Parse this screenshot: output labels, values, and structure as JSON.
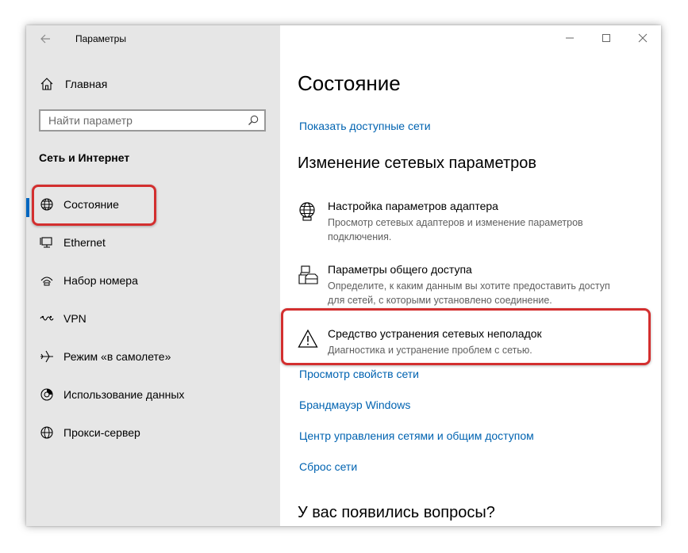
{
  "window": {
    "title": "Параметры",
    "controls": {
      "minimize": "minimize-icon",
      "maximize": "maximize-icon",
      "close": "close-icon"
    }
  },
  "sidebar": {
    "home_label": "Главная",
    "search_placeholder": "Найти параметр",
    "section_title": "Сеть и Интернет",
    "items": [
      {
        "label": "Состояние",
        "icon": "globe-icon",
        "active": true
      },
      {
        "label": "Ethernet",
        "icon": "ethernet-icon"
      },
      {
        "label": "Набор номера",
        "icon": "dialup-icon"
      },
      {
        "label": "VPN",
        "icon": "vpn-icon"
      },
      {
        "label": "Режим «в самолете»",
        "icon": "airplane-icon"
      },
      {
        "label": "Использование данных",
        "icon": "data-usage-icon"
      },
      {
        "label": "Прокси-сервер",
        "icon": "proxy-globe-icon"
      }
    ]
  },
  "main": {
    "title": "Состояние",
    "show_networks_link": "Показать доступные сети",
    "change_heading": "Изменение сетевых параметров",
    "settings": [
      {
        "title": "Настройка параметров адаптера",
        "desc": "Просмотр сетевых адаптеров и изменение параметров подключения.",
        "icon": "adapter-globe-icon"
      },
      {
        "title": "Параметры общего доступа",
        "desc": "Определите, к каким данным вы хотите предоставить доступ для сетей, с которыми установлено соединение.",
        "icon": "sharing-icon"
      },
      {
        "title": "Средство устранения сетевых неполадок",
        "desc": "Диагностика и устранение проблем с сетью.",
        "icon": "warning-icon"
      }
    ],
    "links": [
      "Просмотр свойств сети",
      "Брандмауэр Windows",
      "Центр управления сетями и общим доступом",
      "Сброс сети"
    ],
    "questions_heading": "У вас появились вопросы?"
  },
  "colors": {
    "accent": "#0067c0",
    "link": "#0063b1",
    "highlight": "#d32f2f",
    "sidebar_bg": "#e6e6e6"
  }
}
